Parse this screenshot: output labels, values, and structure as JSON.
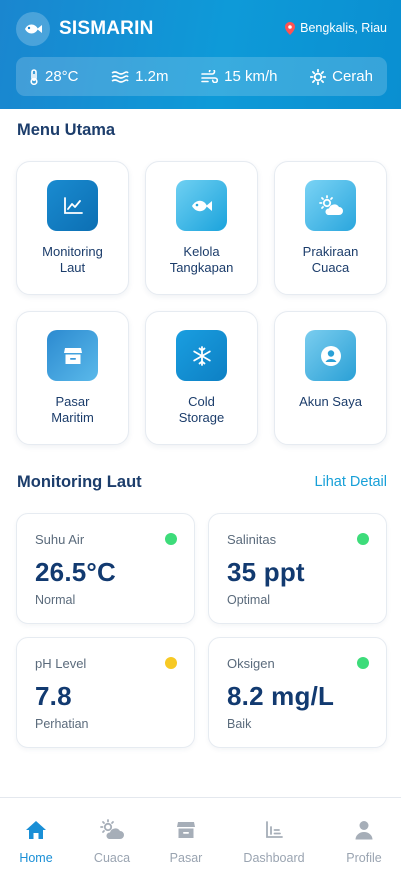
{
  "header": {
    "app_name": "SISMARIN",
    "logo_icon": "fish-icon",
    "location_icon": "map-pin-icon",
    "location": "Bengkalis, Riau",
    "weather": {
      "temperature": "28°C",
      "wave": "1.2m",
      "wind": "15 km/h",
      "condition": "Cerah"
    }
  },
  "menu": {
    "title": "Menu Utama",
    "items": [
      {
        "label": "Monitoring\nLaut",
        "icon": "chart-line-icon"
      },
      {
        "label": "Kelola\nTangkapan",
        "icon": "fish-icon"
      },
      {
        "label": "Prakiraan\nCuaca",
        "icon": "sun-cloud-icon"
      },
      {
        "label": "Pasar\nMaritim",
        "icon": "store-icon"
      },
      {
        "label": "Cold\nStorage",
        "icon": "snowflake-icon"
      },
      {
        "label": "Akun Saya",
        "icon": "user-circle-icon"
      }
    ]
  },
  "monitoring": {
    "title": "Monitoring Laut",
    "detail_link": "Lihat Detail",
    "cards": [
      {
        "label": "Suhu Air",
        "value": "26.5°C",
        "status": "Normal",
        "status_color": "#3ddc7a"
      },
      {
        "label": "Salinitas",
        "value": "35 ppt",
        "status": "Optimal",
        "status_color": "#3ddc7a"
      },
      {
        "label": "pH Level",
        "value": "7.8",
        "status": "Perhatian",
        "status_color": "#f7c924"
      },
      {
        "label": "Oksigen",
        "value": "8.2 mg/L",
        "status": "Baik",
        "status_color": "#3ddc7a"
      }
    ]
  },
  "nav": {
    "active": "Home",
    "items": [
      {
        "label": "Home",
        "icon": "home-icon"
      },
      {
        "label": "Cuaca",
        "icon": "sun-cloud-icon"
      },
      {
        "label": "Pasar",
        "icon": "store-icon"
      },
      {
        "label": "Dashboard",
        "icon": "chart-bar-icon"
      },
      {
        "label": "Profile",
        "icon": "user-icon"
      }
    ]
  },
  "colors": {
    "primary": "#0e9ad8",
    "heading": "#1c3d6b",
    "value": "#123a70",
    "link": "#17a0d8"
  }
}
